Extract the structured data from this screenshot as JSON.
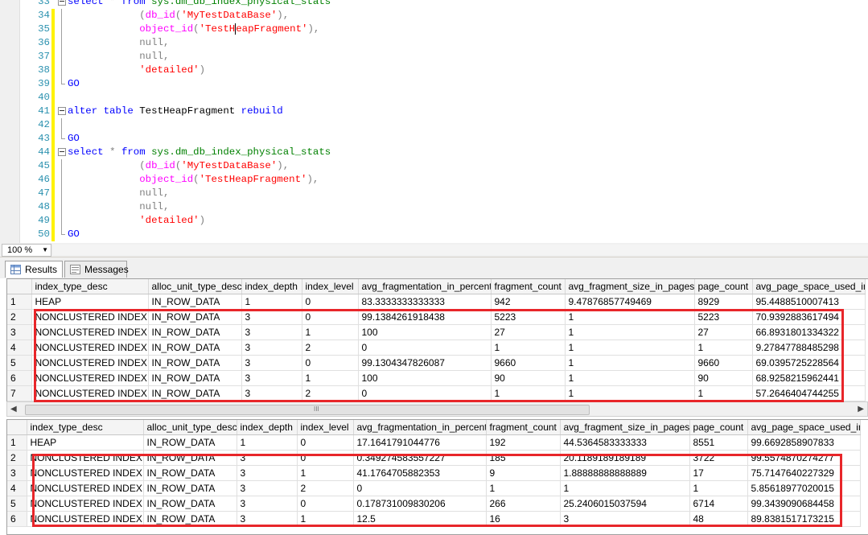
{
  "editor": {
    "lines": [
      {
        "n": "33",
        "ol": "box",
        "chg": false,
        "parts": [
          [
            "kw",
            "select "
          ],
          [
            "gray",
            "* "
          ],
          [
            "kw",
            "from "
          ],
          [
            "sys",
            "sys.dm_db_index_physical_stats"
          ]
        ]
      },
      {
        "n": "34",
        "ol": "vert",
        "chg": true,
        "parts": [
          [
            "plain",
            "            "
          ],
          [
            "gray",
            "("
          ],
          [
            "fn",
            "db_id"
          ],
          [
            "gray",
            "("
          ],
          [
            "str",
            "'MyTestDataBase'"
          ],
          [
            "gray",
            "),"
          ]
        ]
      },
      {
        "n": "35",
        "ol": "vert",
        "chg": true,
        "parts": [
          [
            "plain",
            "            "
          ],
          [
            "fn",
            "object_id"
          ],
          [
            "gray",
            "("
          ],
          [
            "str",
            "'TestH"
          ],
          [
            "caret",
            ""
          ],
          [
            "str",
            "eapFragment'"
          ],
          [
            "gray",
            "),"
          ]
        ]
      },
      {
        "n": "36",
        "ol": "vert",
        "chg": true,
        "parts": [
          [
            "plain",
            "            "
          ],
          [
            "gray",
            "null,"
          ]
        ]
      },
      {
        "n": "37",
        "ol": "vert",
        "chg": true,
        "parts": [
          [
            "plain",
            "            "
          ],
          [
            "gray",
            "null,"
          ]
        ]
      },
      {
        "n": "38",
        "ol": "vert",
        "chg": true,
        "parts": [
          [
            "plain",
            "            "
          ],
          [
            "str",
            "'detailed'"
          ],
          [
            "gray",
            ")"
          ]
        ]
      },
      {
        "n": "39",
        "ol": "end",
        "chg": true,
        "parts": [
          [
            "kw",
            "GO"
          ]
        ]
      },
      {
        "n": "40",
        "ol": "",
        "chg": true,
        "parts": []
      },
      {
        "n": "41",
        "ol": "box",
        "chg": true,
        "parts": [
          [
            "kw",
            "alter table "
          ],
          [
            "plain",
            "TestHeapFragment "
          ],
          [
            "kw",
            "rebuild"
          ]
        ]
      },
      {
        "n": "42",
        "ol": "vert",
        "chg": true,
        "parts": []
      },
      {
        "n": "43",
        "ol": "end",
        "chg": true,
        "parts": [
          [
            "kw",
            "GO"
          ]
        ]
      },
      {
        "n": "44",
        "ol": "box",
        "chg": true,
        "parts": [
          [
            "kw",
            "select "
          ],
          [
            "gray",
            "* "
          ],
          [
            "kw",
            "from "
          ],
          [
            "sys",
            "sys.dm_db_index_physical_stats"
          ]
        ]
      },
      {
        "n": "45",
        "ol": "vert",
        "chg": true,
        "parts": [
          [
            "plain",
            "            "
          ],
          [
            "gray",
            "("
          ],
          [
            "fn",
            "db_id"
          ],
          [
            "gray",
            "("
          ],
          [
            "str",
            "'MyTestDataBase'"
          ],
          [
            "gray",
            "),"
          ]
        ]
      },
      {
        "n": "46",
        "ol": "vert",
        "chg": true,
        "parts": [
          [
            "plain",
            "            "
          ],
          [
            "fn",
            "object_id"
          ],
          [
            "gray",
            "("
          ],
          [
            "str",
            "'TestHeapFragment'"
          ],
          [
            "gray",
            "),"
          ]
        ]
      },
      {
        "n": "47",
        "ol": "vert",
        "chg": true,
        "parts": [
          [
            "plain",
            "            "
          ],
          [
            "gray",
            "null,"
          ]
        ]
      },
      {
        "n": "48",
        "ol": "vert",
        "chg": true,
        "parts": [
          [
            "plain",
            "            "
          ],
          [
            "gray",
            "null,"
          ]
        ]
      },
      {
        "n": "49",
        "ol": "vert",
        "chg": true,
        "parts": [
          [
            "plain",
            "            "
          ],
          [
            "str",
            "'detailed'"
          ],
          [
            "gray",
            ")"
          ]
        ]
      },
      {
        "n": "50",
        "ol": "end",
        "chg": true,
        "parts": [
          [
            "kw",
            "GO"
          ]
        ]
      }
    ]
  },
  "zoom": {
    "value": "100 %"
  },
  "tabs": {
    "results": "Results",
    "messages": "Messages"
  },
  "columns": [
    "index_type_desc",
    "alloc_unit_type_desc",
    "index_depth",
    "index_level",
    "avg_fragmentation_in_percent",
    "fragment_count",
    "avg_fragment_size_in_pages",
    "page_count",
    "avg_page_space_used_in_percent"
  ],
  "grid1": {
    "rows": [
      [
        "1",
        "HEAP",
        "IN_ROW_DATA",
        "1",
        "0",
        "83.3333333333333",
        "942",
        "9.47876857749469",
        "8929",
        "95.4488510007413"
      ],
      [
        "2",
        "NONCLUSTERED INDEX",
        "IN_ROW_DATA",
        "3",
        "0",
        "99.1384261918438",
        "5223",
        "1",
        "5223",
        "70.9392883617494"
      ],
      [
        "3",
        "NONCLUSTERED INDEX",
        "IN_ROW_DATA",
        "3",
        "1",
        "100",
        "27",
        "1",
        "27",
        "66.8931801334322"
      ],
      [
        "4",
        "NONCLUSTERED INDEX",
        "IN_ROW_DATA",
        "3",
        "2",
        "0",
        "1",
        "1",
        "1",
        "9.27847788485298"
      ],
      [
        "5",
        "NONCLUSTERED INDEX",
        "IN_ROW_DATA",
        "3",
        "0",
        "99.1304347826087",
        "9660",
        "1",
        "9660",
        "69.0395725228564"
      ],
      [
        "6",
        "NONCLUSTERED INDEX",
        "IN_ROW_DATA",
        "3",
        "1",
        "100",
        "90",
        "1",
        "90",
        "68.9258215962441"
      ],
      [
        "7",
        "NONCLUSTERED INDEX",
        "IN_ROW_DATA",
        "3",
        "2",
        "0",
        "1",
        "1",
        "1",
        "57.2646404744255"
      ]
    ]
  },
  "grid2": {
    "rows": [
      [
        "1",
        "HEAP",
        "IN_ROW_DATA",
        "1",
        "0",
        "17.1641791044776",
        "192",
        "44.5364583333333",
        "8551",
        "99.6692858907833"
      ],
      [
        "2",
        "NONCLUSTERED INDEX",
        "IN_ROW_DATA",
        "3",
        "0",
        "0.349274583557227",
        "185",
        "20.1189189189189",
        "3722",
        "99.5574870274277"
      ],
      [
        "3",
        "NONCLUSTERED INDEX",
        "IN_ROW_DATA",
        "3",
        "1",
        "41.1764705882353",
        "9",
        "1.88888888888889",
        "17",
        "75.7147640227329"
      ],
      [
        "4",
        "NONCLUSTERED INDEX",
        "IN_ROW_DATA",
        "3",
        "2",
        "0",
        "1",
        "1",
        "1",
        "5.85618977020015"
      ],
      [
        "5",
        "NONCLUSTERED INDEX",
        "IN_ROW_DATA",
        "3",
        "0",
        "0.178731009830206",
        "266",
        "25.2406015037594",
        "6714",
        "99.3439090684458"
      ],
      [
        "6",
        "NONCLUSTERED INDEX",
        "IN_ROW_DATA",
        "3",
        "1",
        "12.5",
        "16",
        "3",
        "48",
        "89.8381517173215"
      ]
    ]
  },
  "scrollbar": {
    "grip": "III"
  },
  "colors": {
    "highlight": "#e8262a",
    "keyword": "#0000ff",
    "function": "#ff00ff",
    "system": "#008000",
    "string": "#ff0000"
  }
}
